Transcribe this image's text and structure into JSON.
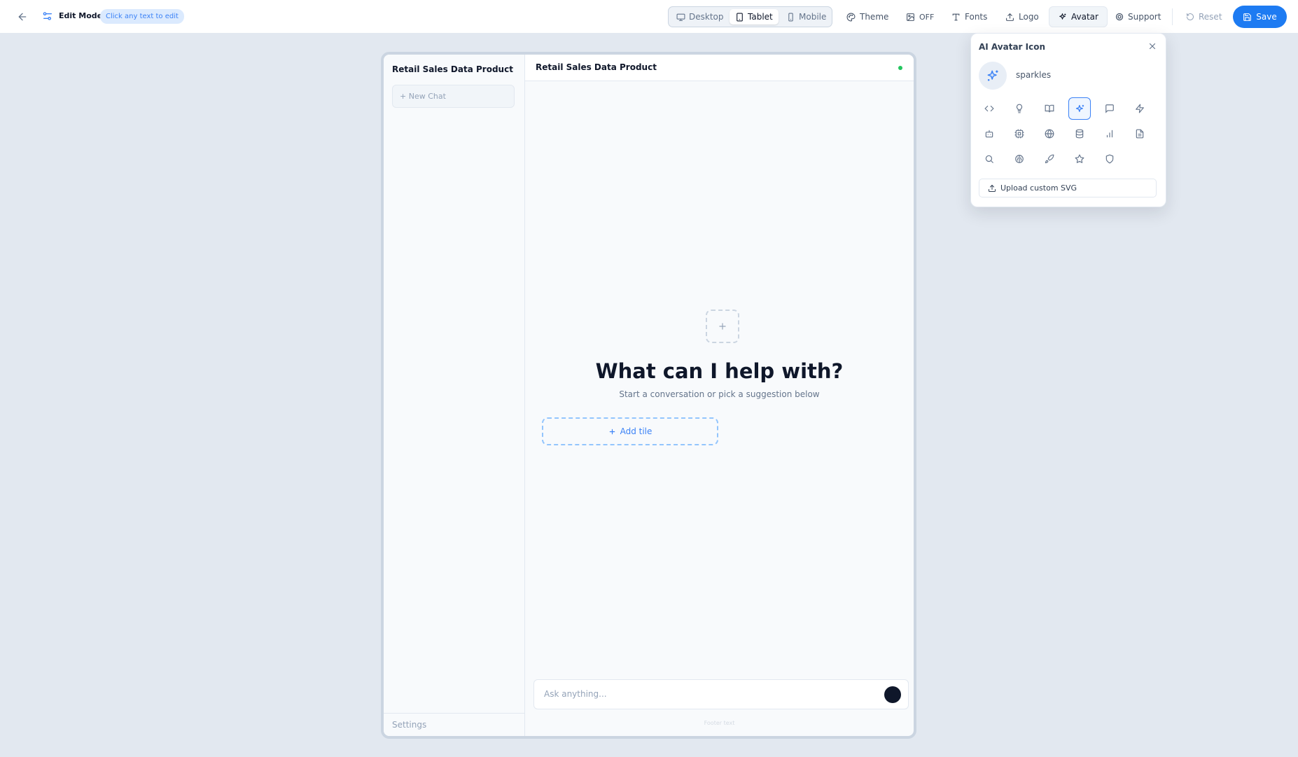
{
  "toolbar": {
    "mode_label": "Edit Mode",
    "hint": "Click any text to edit",
    "devices": [
      {
        "label": "Desktop",
        "icon": "monitor-icon"
      },
      {
        "label": "Tablet",
        "icon": "tablet-icon",
        "active": true
      },
      {
        "label": "Mobile",
        "icon": "phone-icon"
      }
    ],
    "theme_label": "Theme",
    "image_toggle_label": "OFF",
    "fonts_label": "Fonts",
    "logo_label": "Logo",
    "avatar_label": "Avatar",
    "support_label": "Support",
    "reset_label": "Reset",
    "save_label": "Save"
  },
  "sidebar": {
    "title": "Retail Sales Data Product",
    "new_chat": "+ New Chat",
    "footer": "Settings"
  },
  "main": {
    "header_title": "Retail Sales Data Product",
    "headline": "What can I help with?",
    "subline": "Start a conversation or pick a suggestion below",
    "add_tile": "Add tile",
    "composer_placeholder": "Ask anything...",
    "footer_text": "Footer text"
  },
  "avatar_popover": {
    "title": "AI Avatar Icon",
    "selected_name": "sparkles",
    "icons": [
      "code",
      "lightbulb",
      "book",
      "sparkles",
      "message",
      "zap",
      "bot",
      "cpu",
      "globe",
      "database",
      "bar-chart",
      "file-text",
      "search",
      "brain",
      "rocket",
      "star",
      "shield"
    ],
    "upload_label": "Upload custom SVG"
  },
  "colors": {
    "accent": "#1d7bf2",
    "background": "#e2e8f0",
    "status_online": "#22c55e"
  }
}
